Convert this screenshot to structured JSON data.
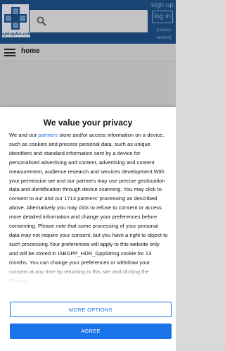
{
  "header": {
    "logo_text": "cplusplus.com",
    "signup_label": "sign up",
    "login_label": "log in",
    "legacy_label": "[Legacy version]"
  },
  "nav": {
    "title": "home"
  },
  "consent": {
    "title": "We value your privacy",
    "body_before_link": "We and our ",
    "link_text": "partners",
    "body_after_link": " store and/or access information on a device, such as cookies and process personal data, such as unique identifiers and standard information sent by a device for personalised advertising and content, advertising and content measurement, audience research and services development.With your permission we and our partners may use precise geolocation data and identification through device scanning. You may click to consent to our and our 1713 partners' processing as described above. Alternatively you may click to refuse to consent or access more detailed information and change your preferences before consenting. Please note that some processing of your personal data may not require your consent, but you have a right to object to such processing.Your preferences will apply to this website only and will be stored in IABGPP_HDR_GppString cookie for 13 months. You can change your preferences or withdraw your consent at any time by returning to this site and clicking the \"Privacy\"",
    "more_options_label": "MORE OPTIONS",
    "agree_label": "AGREE"
  },
  "colors": {
    "header_bg": "#1d4f86",
    "accent": "#1a73e8",
    "header_text": "#8fb1d6"
  }
}
